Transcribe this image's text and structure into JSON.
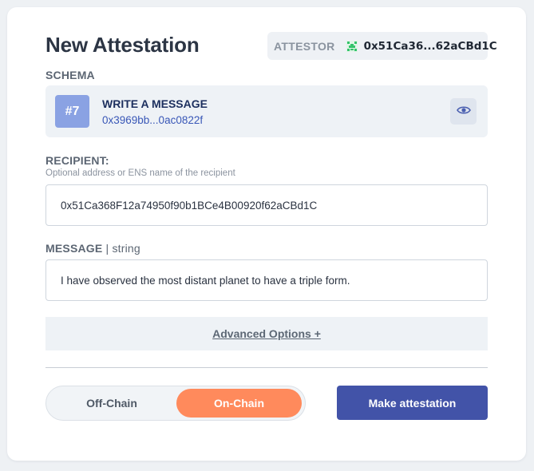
{
  "title": "New Attestation",
  "attestor": {
    "label": "ATTESTOR",
    "address": "0x51Ca36...62aCBd1C",
    "icon": "avatar-icon"
  },
  "schema": {
    "label": "SCHEMA",
    "number": "#7",
    "name": "WRITE A MESSAGE",
    "uid": "0x3969bb...0ac0822f",
    "view_icon": "eye-icon"
  },
  "recipient": {
    "label": "RECIPIENT:",
    "hint": "Optional address or ENS name of the recipient",
    "value": "0x51Ca368F12a74950f90b1BCe4B00920f62aCBd1C"
  },
  "message": {
    "label": "MESSAGE",
    "type": "| string",
    "value": "I have observed the most distant planet to have a triple form."
  },
  "advanced_label": "Advanced Options +",
  "toggle": {
    "off_label": "Off-Chain",
    "on_label": "On-Chain",
    "selected": "On-Chain"
  },
  "submit_label": "Make attestation",
  "colors": {
    "accent_orange": "#ff8a5c",
    "primary_blue": "#4253a8",
    "schema_badge": "#8aa2e3"
  }
}
